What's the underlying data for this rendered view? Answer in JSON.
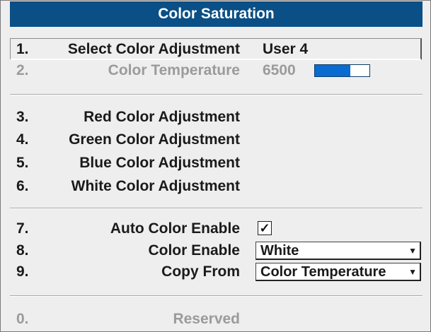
{
  "menu": {
    "title": "Color Saturation",
    "items": [
      {
        "num": "1.",
        "label": "Select Color Adjustment",
        "value": "User 4"
      },
      {
        "num": "2.",
        "label": "Color Temperature",
        "value": "6500",
        "level": 0.65
      },
      {
        "num": "3.",
        "label": "Red Color Adjustment"
      },
      {
        "num": "4.",
        "label": "Green Color Adjustment"
      },
      {
        "num": "5.",
        "label": "Blue Color Adjustment"
      },
      {
        "num": "6.",
        "label": "White Color Adjustment"
      },
      {
        "num": "7.",
        "label": "Auto Color Enable",
        "checked": true
      },
      {
        "num": "8.",
        "label": "Color Enable",
        "value": "White"
      },
      {
        "num": "9.",
        "label": "Copy From",
        "value": "Color Temperature"
      },
      {
        "num": "0.",
        "label": "Reserved"
      }
    ]
  },
  "icons": {
    "checkbox_mark": "✓",
    "dropdown_arrow": "▼"
  },
  "colors": {
    "title_bar": "#0a4f86",
    "bar_fill": "#0a6bd1",
    "disabled_text": "#9b9b9b"
  }
}
